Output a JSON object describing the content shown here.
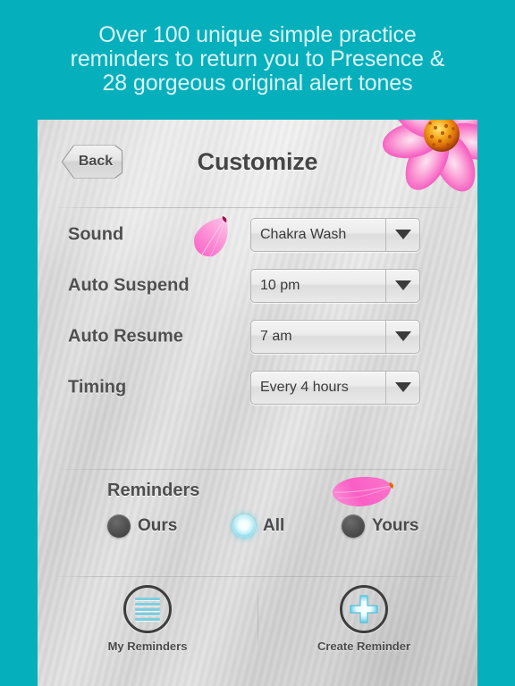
{
  "promo": {
    "line1": "Over 100 unique simple practice",
    "line2": "reminders to return you to Presence &",
    "line3": "28 gorgeous original alert tones",
    "text_color": "#d9f4f6",
    "background_color": "#06afbc"
  },
  "navbar": {
    "back_label": "Back",
    "title": "Customize"
  },
  "decorations": {
    "flower": "cosmos-flower",
    "petal_sound": "pink-petal",
    "petal_yours": "pink-petal",
    "petal_color": "#f965c8"
  },
  "form": {
    "rows": [
      {
        "label": "Sound",
        "value": "Chakra Wash",
        "control": "dropdown"
      },
      {
        "label": "Auto Suspend",
        "value": "10 pm",
        "control": "dropdown"
      },
      {
        "label": "Auto Resume",
        "value": "7 am",
        "control": "dropdown"
      },
      {
        "label": "Timing",
        "value": "Every 4 hours",
        "control": "dropdown"
      }
    ]
  },
  "reminders": {
    "title": "Reminders",
    "options": [
      {
        "label": "Ours",
        "selected": false
      },
      {
        "label": "All",
        "selected": true
      },
      {
        "label": "Yours",
        "selected": false
      }
    ],
    "selected_color": "#26b9d3"
  },
  "toolbar": {
    "my_reminders_label": "My Reminders",
    "create_reminder_label": "Create Reminder",
    "icon_accent_color": "#7ccfe0"
  }
}
